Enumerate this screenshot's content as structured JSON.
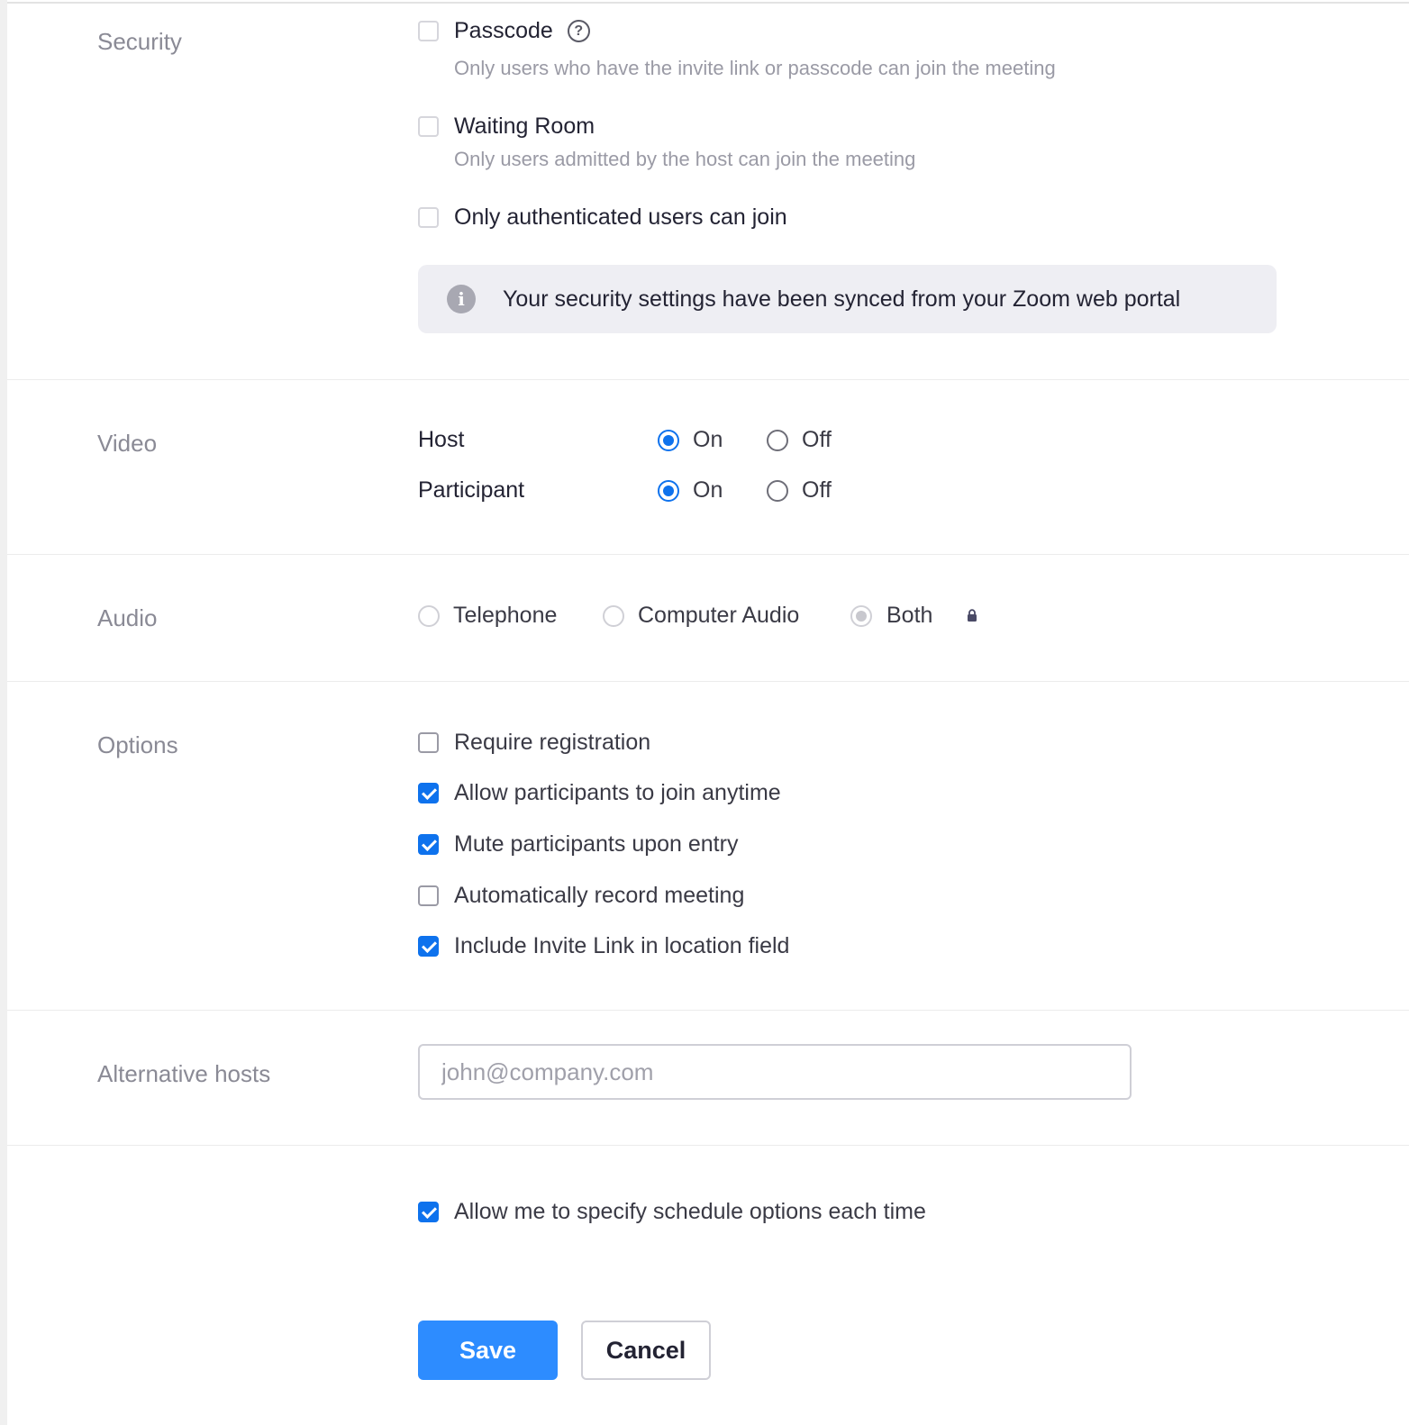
{
  "security": {
    "label": "Security",
    "passcode_label": "Passcode",
    "passcode_desc": "Only users who have the invite link or passcode can join the meeting",
    "waiting_room_label": "Waiting Room",
    "waiting_room_desc": "Only users admitted by the host can join the meeting",
    "authenticated_label": "Only authenticated users can join",
    "banner_text": "Your security settings have been synced from your Zoom web portal",
    "help_icon_glyph": "?",
    "info_icon_glyph": "i"
  },
  "video": {
    "label": "Video",
    "host_label": "Host",
    "participant_label": "Participant",
    "on_label": "On",
    "off_label": "Off",
    "host_value": "On",
    "participant_value": "On"
  },
  "audio": {
    "label": "Audio",
    "options": [
      "Telephone",
      "Computer Audio",
      "Both"
    ],
    "selected": "Both",
    "locked": true
  },
  "options": {
    "label": "Options",
    "items": [
      {
        "label": "Require registration",
        "checked": false
      },
      {
        "label": "Allow participants to join anytime",
        "checked": true
      },
      {
        "label": "Mute participants upon entry",
        "checked": true
      },
      {
        "label": "Automatically record meeting",
        "checked": false
      },
      {
        "label": "Include Invite Link in location field",
        "checked": true
      }
    ]
  },
  "alt_hosts": {
    "label": "Alternative hosts",
    "placeholder": "john@company.com",
    "value": ""
  },
  "schedule_options": {
    "label": "Allow me to specify schedule options each time",
    "checked": true
  },
  "actions": {
    "save_label": "Save",
    "cancel_label": "Cancel"
  },
  "colors": {
    "accent": "#0e72ed",
    "save_button": "#2d8cff",
    "banner_bg": "#eeeef3"
  }
}
